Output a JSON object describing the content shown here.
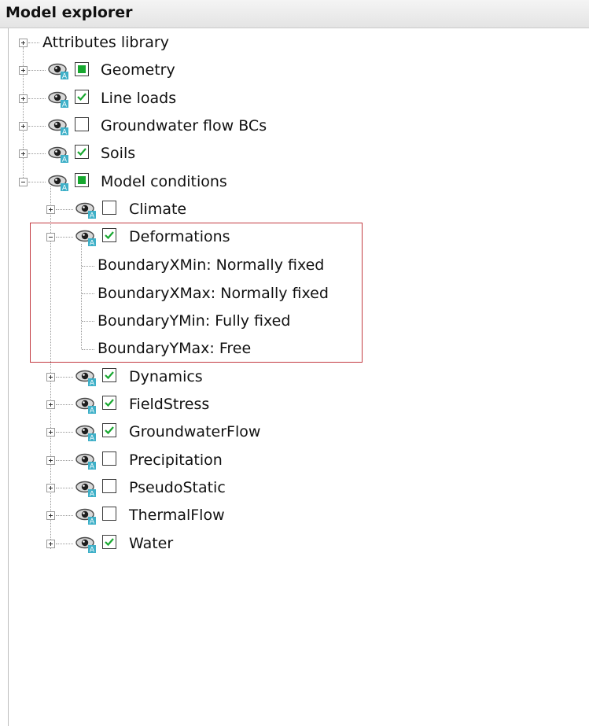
{
  "header": {
    "title": "Model explorer"
  },
  "tree": {
    "attributes_library": "Attributes library",
    "geometry": "Geometry",
    "line_loads": "Line loads",
    "groundwater_flow_bcs": "Groundwater flow BCs",
    "soils": "Soils",
    "model_conditions": "Model conditions",
    "climate": "Climate",
    "deformations": "Deformations",
    "deformation_items": [
      "BoundaryXMin: Normally fixed",
      "BoundaryXMax: Normally fixed",
      "BoundaryYMin: Fully fixed",
      "BoundaryYMax: Free"
    ],
    "dynamics": "Dynamics",
    "fieldstress": "FieldStress",
    "groundwaterflow": "GroundwaterFlow",
    "precipitation": "Precipitation",
    "pseudostatic": "PseudoStatic",
    "thermalflow": "ThermalFlow",
    "water": "Water"
  },
  "colors": {
    "check_green": "#18a830",
    "highlight_red": "#c33b42",
    "eye_badge": "#3fb0c8"
  }
}
